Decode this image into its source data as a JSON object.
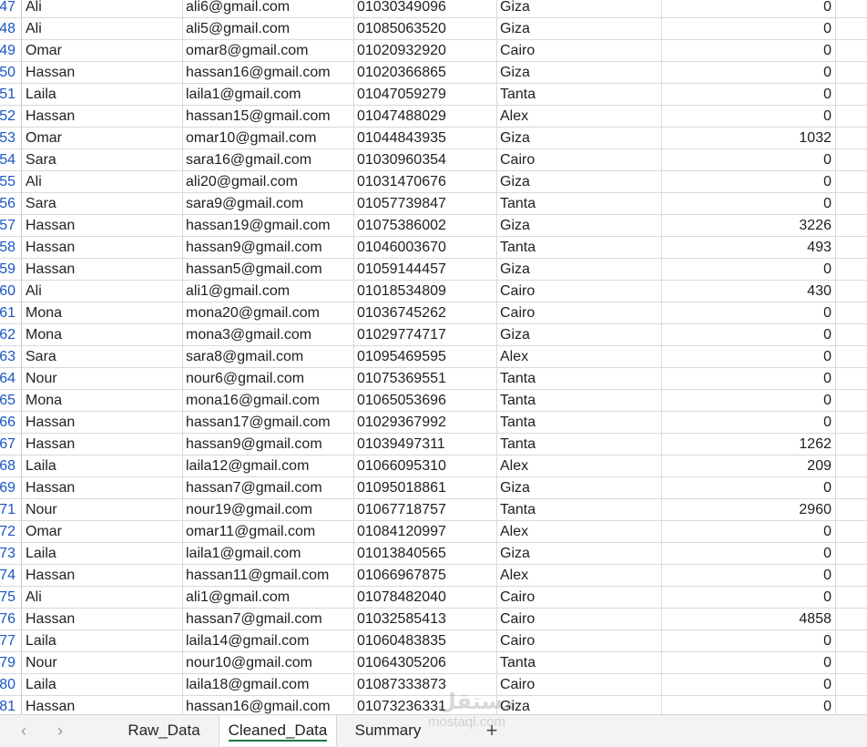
{
  "rows": [
    {
      "num": "47",
      "name": "Ali",
      "email": "ali6@gmail.com",
      "phone": "01030349096",
      "city": "Giza",
      "amount": "0"
    },
    {
      "num": "48",
      "name": "Ali",
      "email": "ali5@gmail.com",
      "phone": "01085063520",
      "city": "Giza",
      "amount": "0"
    },
    {
      "num": "49",
      "name": "Omar",
      "email": "omar8@gmail.com",
      "phone": "01020932920",
      "city": "Cairo",
      "amount": "0"
    },
    {
      "num": "50",
      "name": "Hassan",
      "email": "hassan16@gmail.com",
      "phone": "01020366865",
      "city": "Giza",
      "amount": "0"
    },
    {
      "num": "51",
      "name": "Laila",
      "email": "laila1@gmail.com",
      "phone": "01047059279",
      "city": "Tanta",
      "amount": "0"
    },
    {
      "num": "52",
      "name": "Hassan",
      "email": "hassan15@gmail.com",
      "phone": "01047488029",
      "city": "Alex",
      "amount": "0"
    },
    {
      "num": "53",
      "name": "Omar",
      "email": "omar10@gmail.com",
      "phone": "01044843935",
      "city": "Giza",
      "amount": "1032"
    },
    {
      "num": "54",
      "name": "Sara",
      "email": "sara16@gmail.com",
      "phone": "01030960354",
      "city": "Cairo",
      "amount": "0"
    },
    {
      "num": "55",
      "name": "Ali",
      "email": "ali20@gmail.com",
      "phone": "01031470676",
      "city": "Giza",
      "amount": "0"
    },
    {
      "num": "56",
      "name": "Sara",
      "email": "sara9@gmail.com",
      "phone": "01057739847",
      "city": "Tanta",
      "amount": "0"
    },
    {
      "num": "57",
      "name": "Hassan",
      "email": "hassan19@gmail.com",
      "phone": "01075386002",
      "city": "Giza",
      "amount": "3226"
    },
    {
      "num": "58",
      "name": "Hassan",
      "email": "hassan9@gmail.com",
      "phone": "01046003670",
      "city": "Tanta",
      "amount": "493"
    },
    {
      "num": "59",
      "name": "Hassan",
      "email": "hassan5@gmail.com",
      "phone": "01059144457",
      "city": "Giza",
      "amount": "0"
    },
    {
      "num": "60",
      "name": "Ali",
      "email": "ali1@gmail.com",
      "phone": "01018534809",
      "city": "Cairo",
      "amount": "430"
    },
    {
      "num": "61",
      "name": "Mona",
      "email": "mona20@gmail.com",
      "phone": "01036745262",
      "city": "Cairo",
      "amount": "0"
    },
    {
      "num": "62",
      "name": "Mona",
      "email": "mona3@gmail.com",
      "phone": "01029774717",
      "city": "Giza",
      "amount": "0"
    },
    {
      "num": "63",
      "name": "Sara",
      "email": "sara8@gmail.com",
      "phone": "01095469595",
      "city": "Alex",
      "amount": "0"
    },
    {
      "num": "64",
      "name": "Nour",
      "email": "nour6@gmail.com",
      "phone": "01075369551",
      "city": "Tanta",
      "amount": "0"
    },
    {
      "num": "65",
      "name": "Mona",
      "email": "mona16@gmail.com",
      "phone": "01065053696",
      "city": "Tanta",
      "amount": "0"
    },
    {
      "num": "66",
      "name": "Hassan",
      "email": "hassan17@gmail.com",
      "phone": "01029367992",
      "city": "Tanta",
      "amount": "0"
    },
    {
      "num": "67",
      "name": "Hassan",
      "email": "hassan9@gmail.com",
      "phone": "01039497311",
      "city": "Tanta",
      "amount": "1262"
    },
    {
      "num": "68",
      "name": "Laila",
      "email": "laila12@gmail.com",
      "phone": "01066095310",
      "city": "Alex",
      "amount": "209"
    },
    {
      "num": "69",
      "name": "Hassan",
      "email": "hassan7@gmail.com",
      "phone": "01095018861",
      "city": "Giza",
      "amount": "0"
    },
    {
      "num": "71",
      "name": "Nour",
      "email": "nour19@gmail.com",
      "phone": "01067718757",
      "city": "Tanta",
      "amount": "2960"
    },
    {
      "num": "72",
      "name": "Omar",
      "email": "omar11@gmail.com",
      "phone": "01084120997",
      "city": "Alex",
      "amount": "0"
    },
    {
      "num": "73",
      "name": "Laila",
      "email": "laila1@gmail.com",
      "phone": "01013840565",
      "city": "Giza",
      "amount": "0"
    },
    {
      "num": "74",
      "name": "Hassan",
      "email": "hassan11@gmail.com",
      "phone": "01066967875",
      "city": "Alex",
      "amount": "0"
    },
    {
      "num": "75",
      "name": "Ali",
      "email": "ali1@gmail.com",
      "phone": "01078482040",
      "city": "Cairo",
      "amount": "0"
    },
    {
      "num": "76",
      "name": "Hassan",
      "email": "hassan7@gmail.com",
      "phone": "01032585413",
      "city": "Cairo",
      "amount": "4858"
    },
    {
      "num": "77",
      "name": "Laila",
      "email": "laila14@gmail.com",
      "phone": "01060483835",
      "city": "Cairo",
      "amount": "0"
    },
    {
      "num": "79",
      "name": "Nour",
      "email": "nour10@gmail.com",
      "phone": "01064305206",
      "city": "Tanta",
      "amount": "0"
    },
    {
      "num": "80",
      "name": "Laila",
      "email": "laila18@gmail.com",
      "phone": "01087333873",
      "city": "Cairo",
      "amount": "0"
    },
    {
      "num": "81",
      "name": "Hassan",
      "email": "hassan16@gmail.com",
      "phone": "01073236331",
      "city": "Giza",
      "amount": "0"
    }
  ],
  "tabs": {
    "prev_icon": "chevron-left-icon",
    "next_icon": "chevron-right-icon",
    "sheets": [
      "Raw_Data",
      "Cleaned_Data",
      "Summary"
    ],
    "active": "Cleaned_Data",
    "add_icon": "plus-icon",
    "add_glyph": "+"
  },
  "watermark": {
    "logo": "مستقل",
    "text": "mostaql.com"
  },
  "colors": {
    "accent": "#107c41",
    "row_number": "#1a56c4",
    "gridline": "#d9d9d9"
  }
}
